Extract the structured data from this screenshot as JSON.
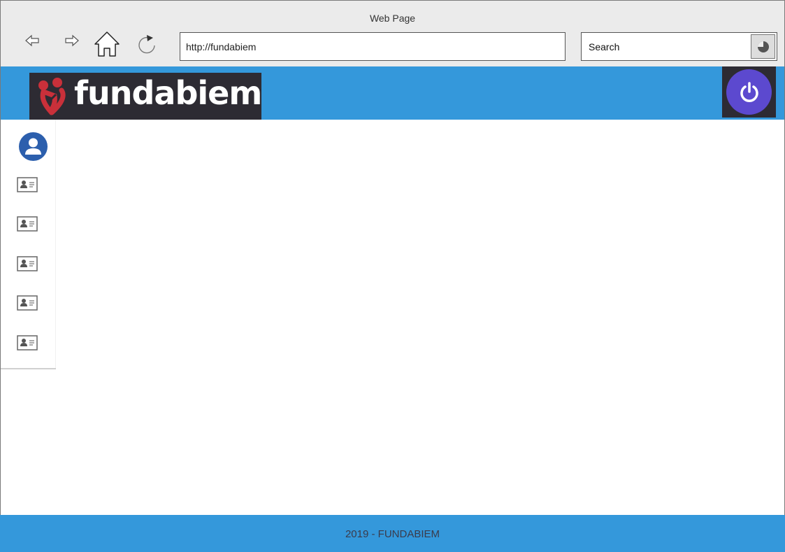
{
  "browser": {
    "title": "Web Page",
    "url": "http://fundabiem",
    "search_label": "Search"
  },
  "header": {
    "logo_text": "fundabiem",
    "colors": {
      "header_bg": "#3498db",
      "logo_bg": "#2d2b33",
      "power_btn": "#5c49cf"
    }
  },
  "sidebar": {
    "items": [
      {
        "icon": "contact-card-icon"
      },
      {
        "icon": "contact-card-icon"
      },
      {
        "icon": "contact-card-icon"
      },
      {
        "icon": "contact-card-icon"
      },
      {
        "icon": "contact-card-icon"
      }
    ]
  },
  "footer": {
    "text": "2019 - FUNDABIEM"
  }
}
